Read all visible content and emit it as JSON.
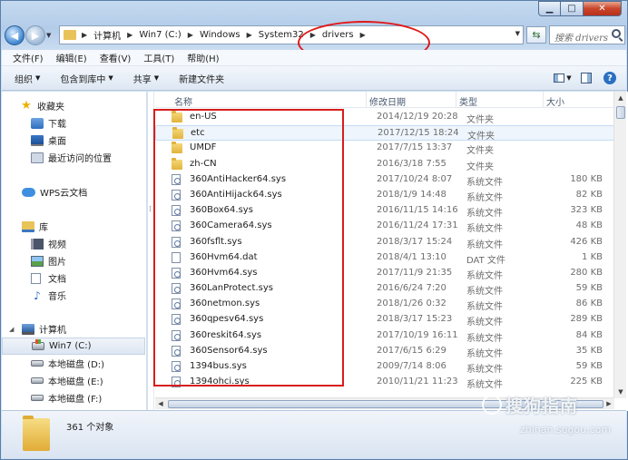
{
  "address": {
    "crumbs": [
      "计算机",
      "Win7 (C:)",
      "Windows",
      "System32",
      "drivers"
    ]
  },
  "search": {
    "placeholder": "搜索 drivers"
  },
  "menu": [
    "文件(F)",
    "编辑(E)",
    "查看(V)",
    "工具(T)",
    "帮助(H)"
  ],
  "toolbar": {
    "organize": "组织",
    "include": "包含到库中",
    "share": "共享",
    "new_folder": "新建文件夹"
  },
  "sidebar": {
    "favorites": "收藏夹",
    "downloads": "下载",
    "desktop": "桌面",
    "recent": "最近访问的位置",
    "wps": "WPS云文档",
    "libraries": "库",
    "videos": "视频",
    "pictures": "图片",
    "documents": "文档",
    "music": "音乐",
    "computer": "计算机",
    "win7": "Win7 (C:)",
    "disk_d": "本地磁盘 (D:)",
    "disk_e": "本地磁盘 (E:)",
    "disk_f": "本地磁盘 (F:)"
  },
  "columns": {
    "name": "名称",
    "date": "修改日期",
    "type": "类型",
    "size": "大小"
  },
  "files": [
    {
      "name": "en-US",
      "date": "2014/12/19 20:28",
      "type": "文件夹",
      "size": "",
      "icon": "folder"
    },
    {
      "name": "etc",
      "date": "2017/12/15 18:24",
      "type": "文件夹",
      "size": "",
      "icon": "folder"
    },
    {
      "name": "UMDF",
      "date": "2017/7/15 13:37",
      "type": "文件夹",
      "size": "",
      "icon": "folder"
    },
    {
      "name": "zh-CN",
      "date": "2016/3/18 7:55",
      "type": "文件夹",
      "size": "",
      "icon": "folder"
    },
    {
      "name": "360AntiHacker64.sys",
      "date": "2017/10/24 8:07",
      "type": "系统文件",
      "size": "180 KB",
      "icon": "sys"
    },
    {
      "name": "360AntiHijack64.sys",
      "date": "2018/1/9 14:48",
      "type": "系统文件",
      "size": "82 KB",
      "icon": "sys"
    },
    {
      "name": "360Box64.sys",
      "date": "2016/11/15 14:16",
      "type": "系统文件",
      "size": "323 KB",
      "icon": "sys"
    },
    {
      "name": "360Camera64.sys",
      "date": "2016/11/24 17:31",
      "type": "系统文件",
      "size": "48 KB",
      "icon": "sys"
    },
    {
      "name": "360fsflt.sys",
      "date": "2018/3/17 15:24",
      "type": "系统文件",
      "size": "426 KB",
      "icon": "sys"
    },
    {
      "name": "360Hvm64.dat",
      "date": "2018/4/1 13:10",
      "type": "DAT 文件",
      "size": "1 KB",
      "icon": "dat"
    },
    {
      "name": "360Hvm64.sys",
      "date": "2017/11/9 21:35",
      "type": "系统文件",
      "size": "280 KB",
      "icon": "sys"
    },
    {
      "name": "360LanProtect.sys",
      "date": "2016/6/24 7:20",
      "type": "系统文件",
      "size": "59 KB",
      "icon": "sys"
    },
    {
      "name": "360netmon.sys",
      "date": "2018/1/26 0:32",
      "type": "系统文件",
      "size": "86 KB",
      "icon": "sys"
    },
    {
      "name": "360qpesv64.sys",
      "date": "2018/3/17 15:23",
      "type": "系统文件",
      "size": "289 KB",
      "icon": "sys"
    },
    {
      "name": "360reskit64.sys",
      "date": "2017/10/19 16:11",
      "type": "系统文件",
      "size": "84 KB",
      "icon": "sys"
    },
    {
      "name": "360Sensor64.sys",
      "date": "2017/6/15 6:29",
      "type": "系统文件",
      "size": "35 KB",
      "icon": "sys"
    },
    {
      "name": "1394bus.sys",
      "date": "2009/7/14 8:06",
      "type": "系统文件",
      "size": "59 KB",
      "icon": "sys"
    },
    {
      "name": "1394ohci.sys",
      "date": "2010/11/21 11:23",
      "type": "系统文件",
      "size": "225 KB",
      "icon": "sys"
    }
  ],
  "status": {
    "count": "361 个对象"
  },
  "watermark": {
    "brand": "搜狗指南",
    "url": "zhinan.sogou.com"
  },
  "colors": {
    "annotation_red": "#d81d1d",
    "folder": "#e8c35a",
    "accent": "#3d84cf"
  }
}
